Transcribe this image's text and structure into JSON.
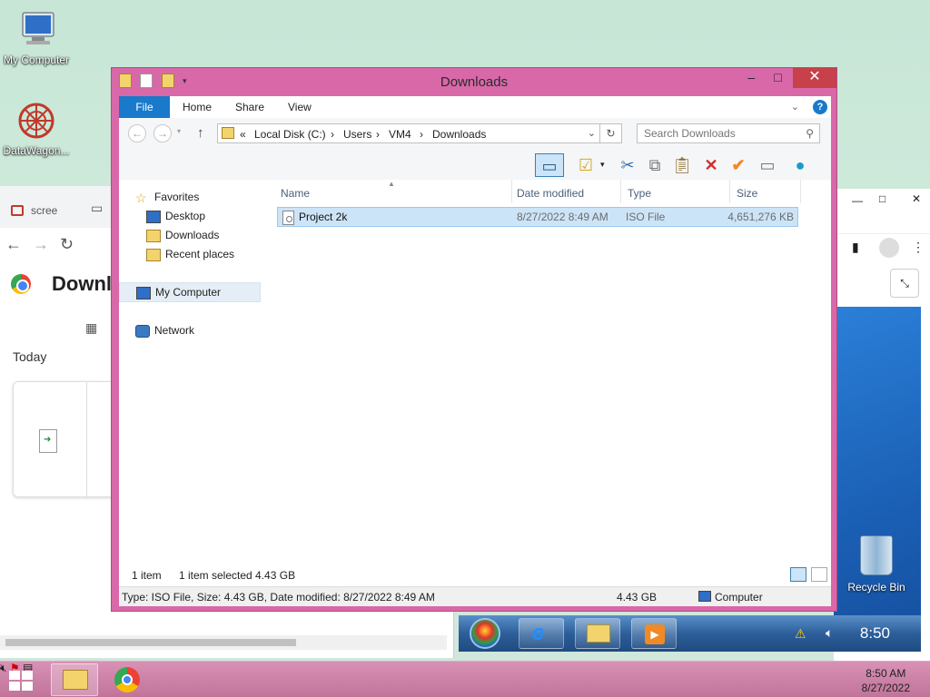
{
  "desktop": {
    "icons": [
      {
        "label": "My Computer"
      },
      {
        "label": "DataWagon..."
      }
    ],
    "recycle_bin": "Recycle Bin"
  },
  "chrome_bg": {
    "tab_title": "scree",
    "page_title": "Downlo",
    "section": "Today"
  },
  "win7": {
    "clock": "8:50"
  },
  "explorer": {
    "title": "Downloads",
    "ribbon_tabs": [
      "File",
      "Home",
      "Share",
      "View"
    ],
    "address": {
      "prefix": "«",
      "crumbs": [
        "Local Disk (C:)",
        "Users",
        "VM4",
        "Downloads"
      ]
    },
    "search_placeholder": "Search Downloads",
    "nav": {
      "favorites": "Favorites",
      "desktop": "Desktop",
      "downloads": "Downloads",
      "recent": "Recent places",
      "computer": "My Computer",
      "network": "Network"
    },
    "columns": [
      "Name",
      "Date modified",
      "Type",
      "Size"
    ],
    "files": [
      {
        "name": "Project 2k",
        "date": "8/27/2022 8:49 AM",
        "type": "ISO File",
        "size": "4,651,276 KB"
      }
    ],
    "status": {
      "count": "1 item",
      "selected": "1 item selected  4.43 GB"
    },
    "details": {
      "info": "Type: ISO File, Size: 4.43 GB, Date modified: 8/27/2022 8:49 AM",
      "size": "4.43 GB",
      "location": "Computer"
    }
  },
  "taskbar": {
    "time": "8:50 AM",
    "date": "8/27/2022"
  },
  "colors": {
    "window_frame": "#d868a8",
    "accent": "#1979ca",
    "selection": "#cce4f7",
    "taskbar": "#c07499"
  }
}
